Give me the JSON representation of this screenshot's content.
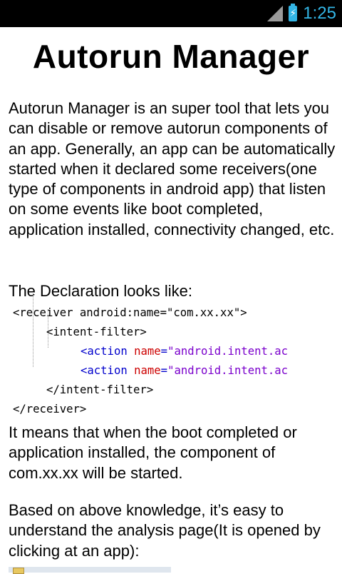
{
  "status_bar": {
    "time": "1:25",
    "signal_icon": "signal-bars-icon",
    "battery_icon": "battery-charging-icon",
    "accent_color": "#33b5e5"
  },
  "page": {
    "title": "Autorun Manager",
    "intro": "Autorun Manager is an super tool that lets you can disable or remove autorun components of an app. Generally, an app can be automatically started when it declared some receivers(one type of components in android app) that listen on some events like boot completed, application installed, connectivity changed, etc.",
    "declaration_heading": "The Declaration looks like:",
    "explanation": "It means that when the boot completed or application installed, the component of com.xx.xx will be started.",
    "analysis": "Based on above knowledge, it’s easy to understand the analysis page(It is opened by clicking at an app):"
  },
  "code": {
    "line1_tag": "<receiver",
    "line1_attr": "android:name",
    "line1_val": "=\"com.xx.xx\">",
    "line2": "<intent-filter>",
    "line3_tag": "<action",
    "line3_attr": "name",
    "line3_eq": "=",
    "line3_val": "\"android.intent.ac",
    "line4_tag": "<action",
    "line4_attr": "name",
    "line4_eq": "=",
    "line4_val": "\"android.intent.ac",
    "line5": "</intent-filter>",
    "line6": "</receiver>"
  }
}
